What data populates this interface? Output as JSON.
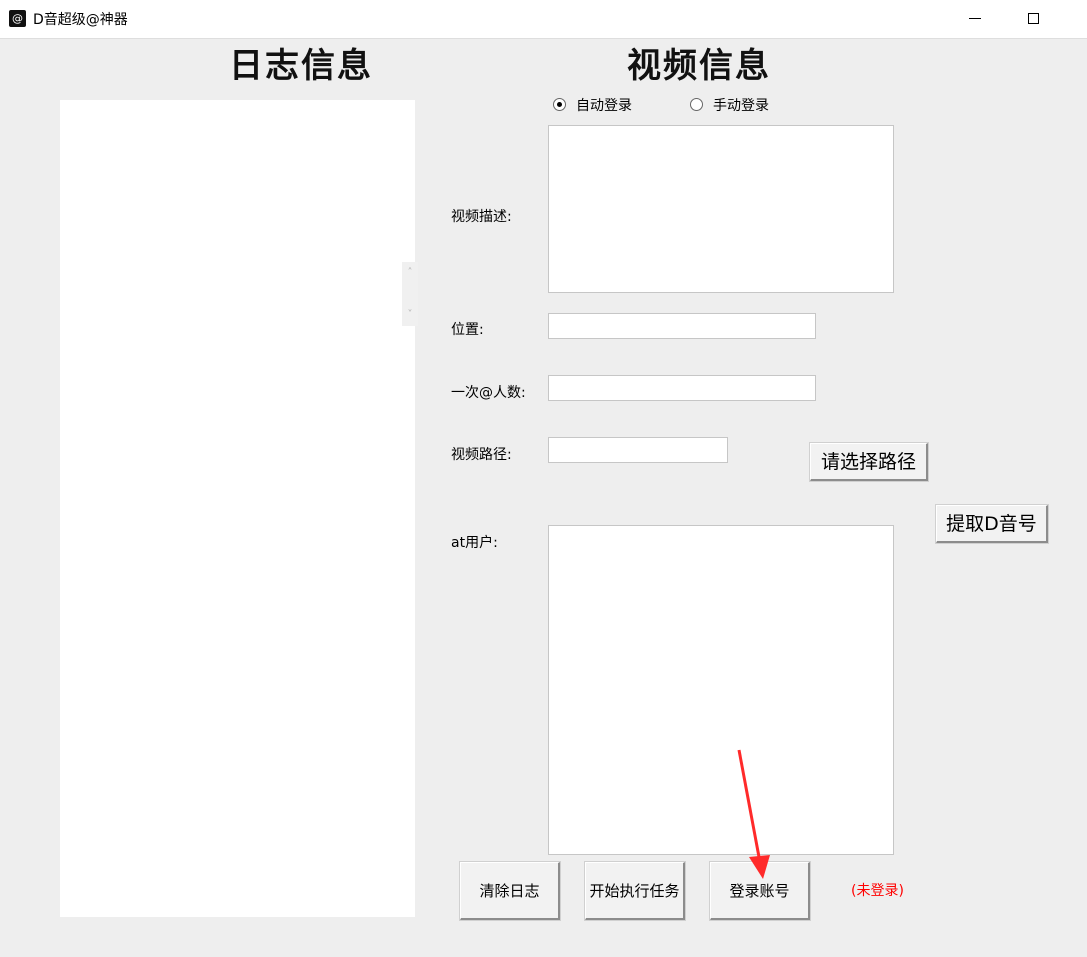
{
  "window": {
    "icon": "@",
    "title": "D音超级@神器"
  },
  "headings": {
    "log": "日志信息",
    "video": "视频信息"
  },
  "log_scroll": {
    "up": "˄",
    "down": "˅"
  },
  "login_mode": {
    "options": [
      {
        "label": "自动登录",
        "checked": true
      },
      {
        "label": "手动登录",
        "checked": false
      }
    ]
  },
  "form": {
    "description_label": "视频描述:",
    "description_value": "",
    "location_label": "位置:",
    "location_value": "",
    "at_count_label": "一次@人数:",
    "at_count_value": "",
    "video_path_label": "视频路径:",
    "video_path_value": "",
    "at_users_label": "at用户:",
    "at_users_value": ""
  },
  "buttons": {
    "choose_path": "请选择路径",
    "extract_id": "提取D音号",
    "clear_log": "清除日志",
    "start_task": "开始执行任务",
    "login_account": "登录账号"
  },
  "status": {
    "text": "(未登录)",
    "color": "#ff0000"
  },
  "annotation": {
    "arrow_color": "#ff2a2a"
  }
}
